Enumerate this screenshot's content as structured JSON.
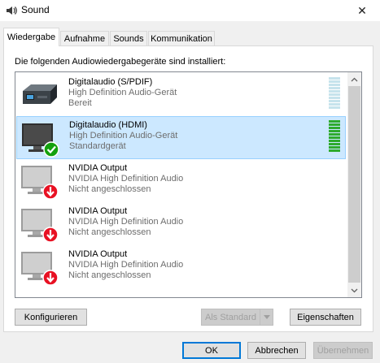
{
  "window": {
    "title": "Sound",
    "close_glyph": "✕"
  },
  "tabs": [
    {
      "label": "Wiedergabe",
      "active": true
    },
    {
      "label": "Aufnahme",
      "active": false
    },
    {
      "label": "Sounds",
      "active": false
    },
    {
      "label": "Kommunikation",
      "active": false
    }
  ],
  "panel": {
    "label": "Die folgenden Audiowiedergabegeräte sind installiert:"
  },
  "devices": [
    {
      "name": "Digitalaudio (S/PDIF)",
      "description": "High Definition Audio-Gerät",
      "status": "Bereit",
      "icon": "spdif-device-icon",
      "selected": false,
      "level_bars_active": 0
    },
    {
      "name": "Digitalaudio (HDMI)",
      "description": "High Definition Audio-Gerät",
      "status": "Standardgerät",
      "icon": "monitor-default-icon",
      "selected": true,
      "level_bars_active": 10
    },
    {
      "name": "NVIDIA Output",
      "description": "NVIDIA High Definition Audio",
      "status": "Nicht angeschlossen",
      "icon": "monitor-disconnected-icon",
      "selected": false
    },
    {
      "name": "NVIDIA Output",
      "description": "NVIDIA High Definition Audio",
      "status": "Nicht angeschlossen",
      "icon": "monitor-disconnected-icon",
      "selected": false
    },
    {
      "name": "NVIDIA Output",
      "description": "NVIDIA High Definition Audio",
      "status": "Nicht angeschlossen",
      "icon": "monitor-disconnected-icon",
      "selected": false
    }
  ],
  "buttons": {
    "configure": "Konfigurieren",
    "set_default": "Als Standard",
    "properties": "Eigenschaften",
    "ok": "OK",
    "cancel": "Abbrechen",
    "apply": "Übernehmen"
  },
  "colors": {
    "selection_bg": "#cce8ff",
    "meter_active": "#2eaa2e",
    "meter_idle": "#c6e3ec",
    "default_check": "#13a10e",
    "disconnected_badge": "#e81123"
  }
}
